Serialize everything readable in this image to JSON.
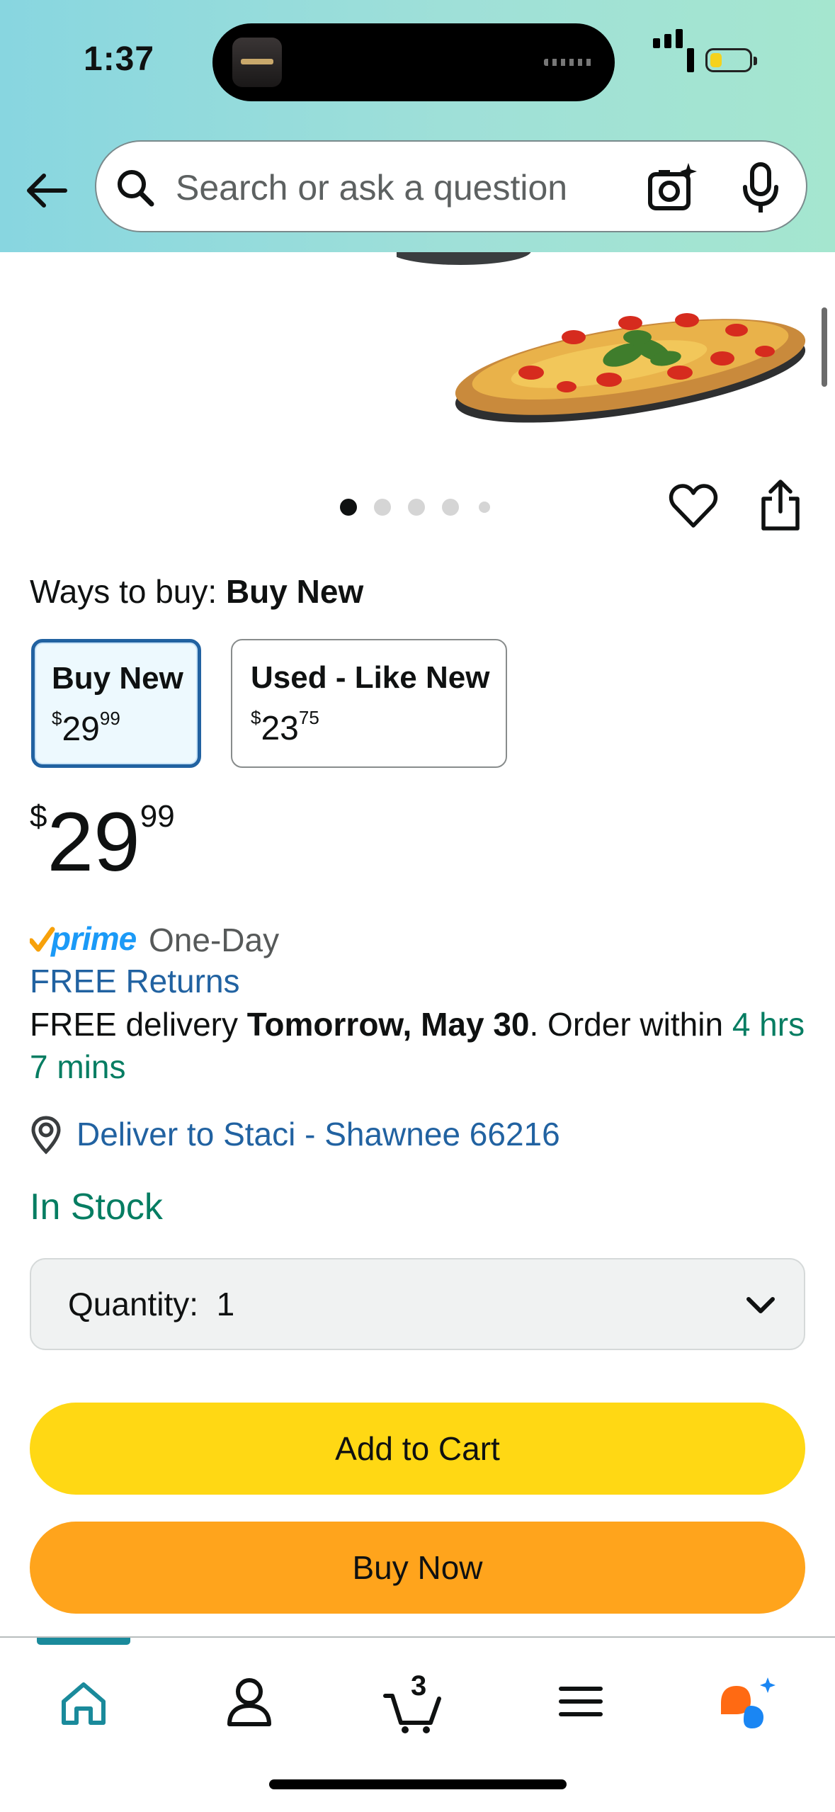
{
  "status_bar": {
    "time": "1:37"
  },
  "search": {
    "placeholder": "Search or ask a question"
  },
  "gallery": {
    "total_images": 5,
    "active_index": 0
  },
  "ways_to_buy": {
    "prefix": "Ways to buy:",
    "selected": "Buy New"
  },
  "options": [
    {
      "label": "Buy New",
      "dollars": "29",
      "cents": "99",
      "currency": "$",
      "selected": true
    },
    {
      "label": "Used - Like New",
      "dollars": "23",
      "cents": "75",
      "currency": "$",
      "selected": false
    }
  ],
  "price": {
    "currency": "$",
    "dollars": "29",
    "cents": "99"
  },
  "prime": {
    "brand": "prime",
    "service": "One-Day"
  },
  "free_returns": "FREE Returns",
  "delivery": {
    "prefix": "FREE delivery ",
    "date": "Tomorrow, May 30",
    "middle": ". Order within ",
    "countdown": "4 hrs 7 mins"
  },
  "deliver_to": "Deliver to Staci - Shawnee 66216",
  "stock_status": "In Stock",
  "quantity": {
    "label": "Quantity:",
    "value": "1"
  },
  "buttons": {
    "add_to_cart": "Add to Cart",
    "buy_now": "Buy Now"
  },
  "bottom_nav": {
    "cart_count": "3",
    "items": [
      "home-icon",
      "account-icon",
      "cart-icon",
      "menu-icon",
      "rufus-icon"
    ],
    "active": "home"
  },
  "colors": {
    "header_gradient_start": "#88d6e0",
    "header_gradient_end": "#a5e6cf",
    "link_blue": "#2162a1",
    "stock_green": "#067d62",
    "add_to_cart_yellow": "#ffd814",
    "buy_now_orange": "#ffa41c",
    "nav_active_teal": "#1a8a9b"
  }
}
